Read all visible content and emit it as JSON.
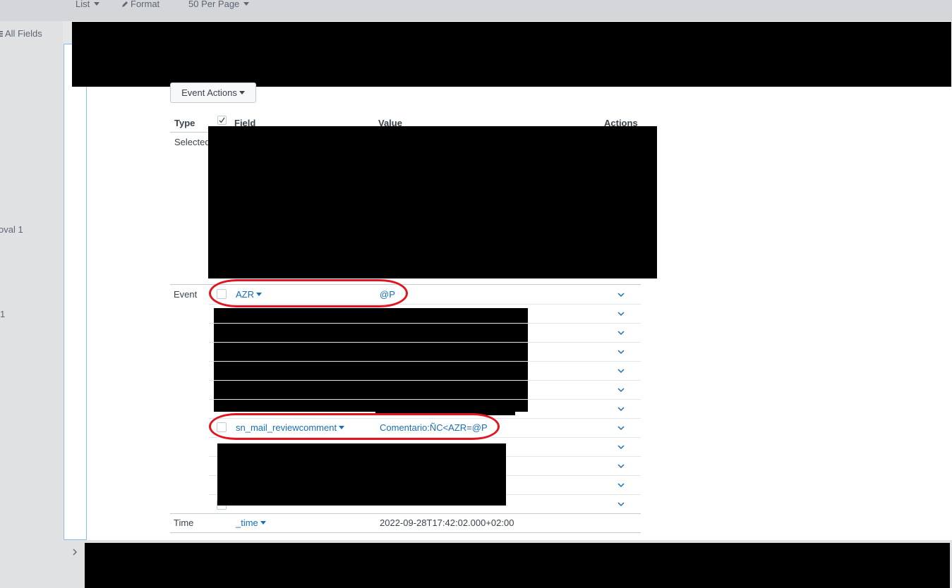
{
  "toolbar": {
    "list_label": "List",
    "format_label": "Format",
    "per_page_label": "50 Per Page"
  },
  "sidebar": {
    "all_fields_label": "All Fields",
    "partial_item_1": "oval  1",
    "partial_item_2": "1"
  },
  "event_actions_label": "Event Actions",
  "table": {
    "headers": {
      "type": "Type",
      "field": "Field",
      "value": "Value",
      "actions": "Actions"
    },
    "selected_group_label": "Selected",
    "event_group_label": "Event",
    "time_group_label": "Time",
    "rows": [
      {
        "field": "AZR",
        "value": "@P"
      },
      {
        "field": "sn_mail_reviewcomment",
        "value": "Comentario:ÑC<AZR=@P"
      }
    ],
    "time_row": {
      "field": "_time",
      "value": "2022-09-28T17:42:02.000+02:00"
    }
  },
  "colors": {
    "link": "#1a6fb4",
    "annotation": "#e0151f",
    "redaction": "#000000"
  }
}
